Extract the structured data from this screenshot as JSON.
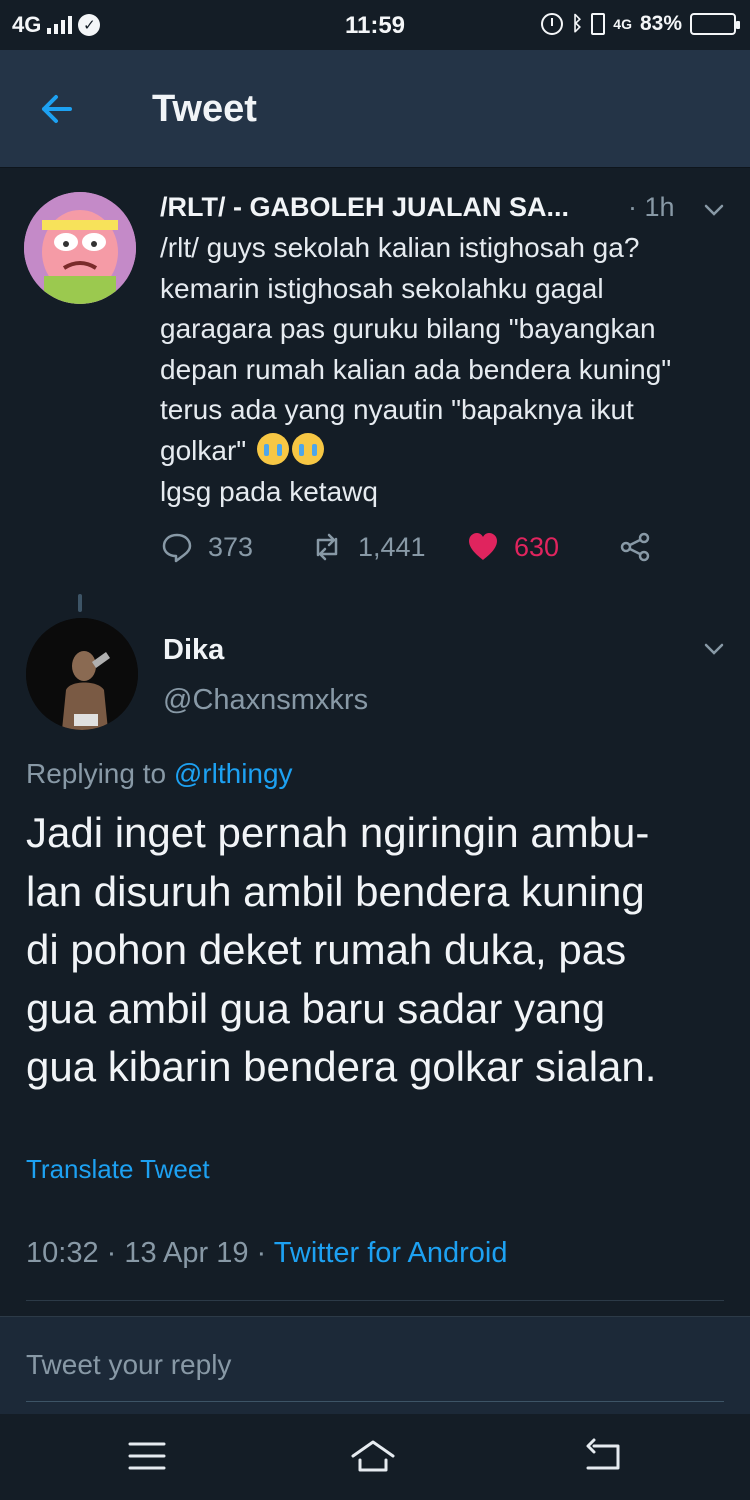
{
  "status_bar": {
    "network": "4G",
    "time": "11:59",
    "data_type": "4G",
    "battery_percent": "83%",
    "battery_level": 0.83
  },
  "header": {
    "title": "Tweet"
  },
  "parent_tweet": {
    "author_name": "/RLT/ - GABOLEH JUALAN SA...",
    "time": "· 1h",
    "text": "/rlt/ guys sekolah kalian istighosah ga?\nkemarin istighosah sekolahku gagal\ngaragara pas guruku bilang \"bayangkan\ndepan rumah kalian ada bendera kuning\"\nterus ada yang nyautin \"bapaknya ikut\ngolkar\"",
    "text_after_emoji": "lgsg pada ketawq",
    "emoji": "crying-face-emoji",
    "reply_count": "373",
    "retweet_count": "1,441",
    "like_count": "630",
    "liked": true
  },
  "main_tweet": {
    "author_name": "Dika",
    "author_handle": "@Chaxnsmxkrs",
    "replying_prefix": "Replying to",
    "replying_handle": "@rlthingy",
    "text": "Jadi inget pernah ngiringin ambu-\nlan disuruh ambil bendera kuning\ndi pohon deket rumah duka, pas\ngua ambil gua baru sadar yang\ngua kibarin bendera golkar sialan.",
    "translate_label": "Translate Tweet",
    "timestamp": "10:32 · 13 Apr 19 ·",
    "source": "Twitter for Android"
  },
  "reply_bar": {
    "placeholder": "Tweet your reply"
  },
  "nav_bar": {
    "icons": [
      "menu-icon",
      "home-icon",
      "back-icon"
    ]
  },
  "colors": {
    "background": "#141d26",
    "header": "#243447",
    "accent": "#1da1f2",
    "like": "#e0245e",
    "muted": "#8899a6"
  }
}
